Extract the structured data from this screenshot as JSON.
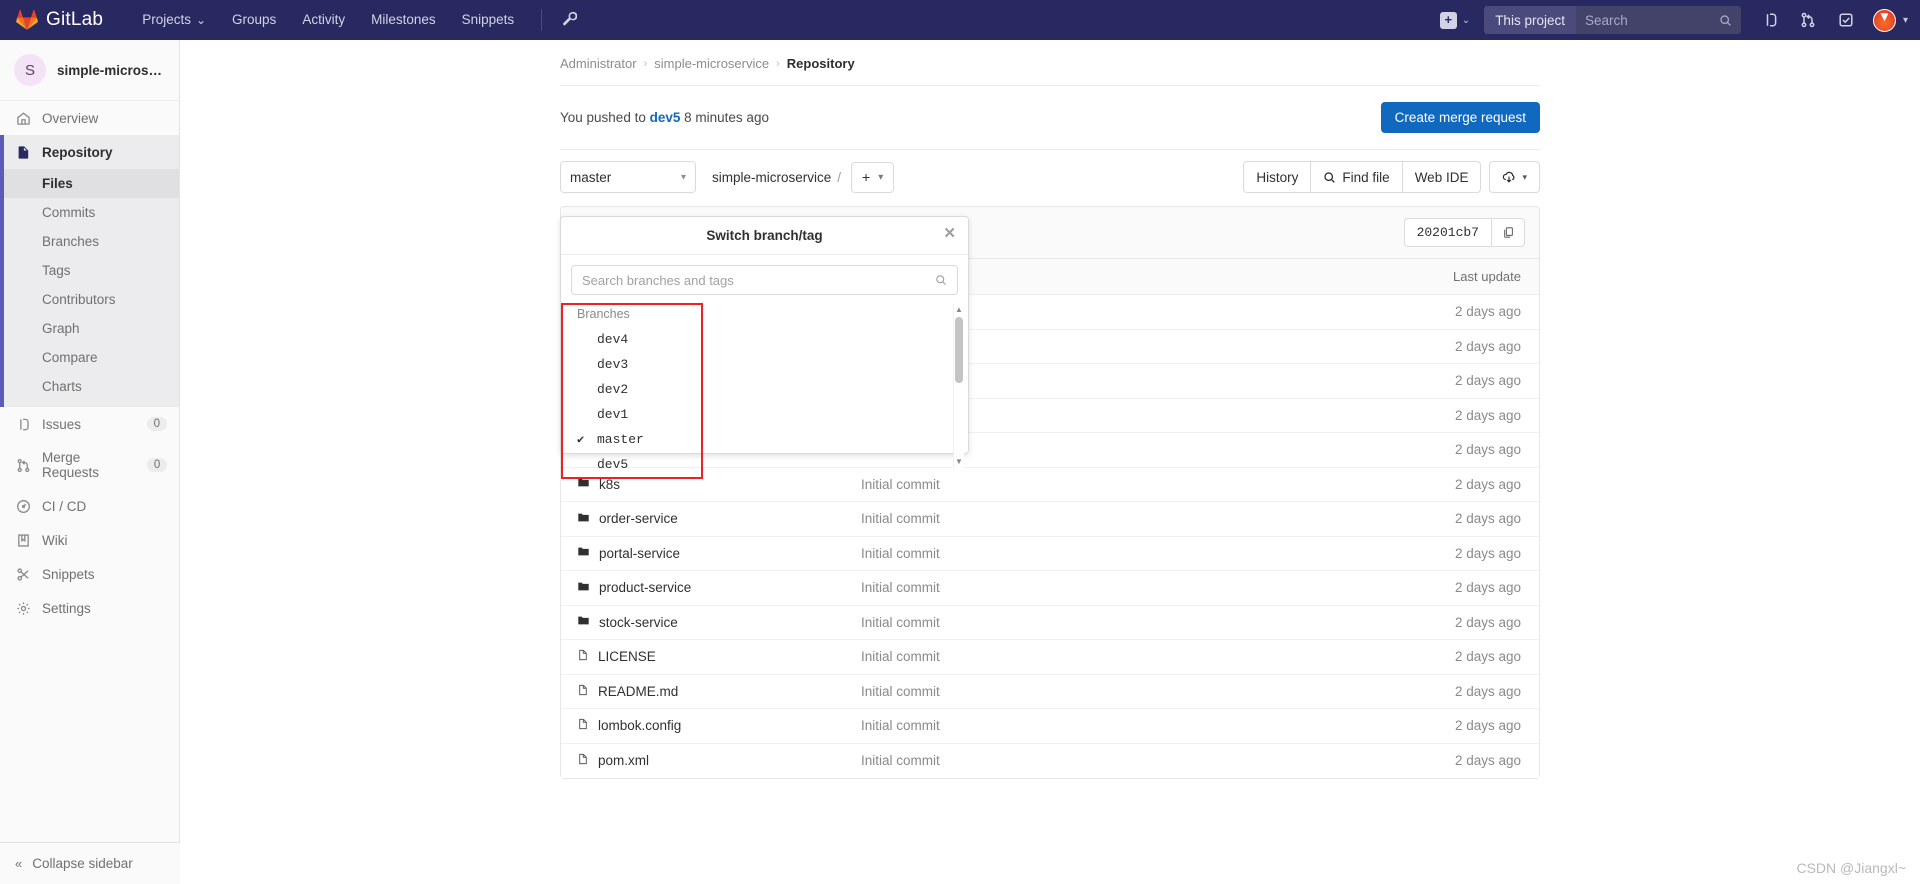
{
  "topnav": {
    "brand": "GitLab",
    "links": [
      {
        "label": "Projects",
        "caret": "⌄"
      },
      {
        "label": "Groups",
        "caret": ""
      },
      {
        "label": "Activity",
        "caret": ""
      },
      {
        "label": "Milestones",
        "caret": ""
      },
      {
        "label": "Snippets",
        "caret": ""
      }
    ],
    "wrench_icon": "wrench-icon",
    "plus_label": "+",
    "plus_caret": "⌄",
    "this_project": "This project",
    "search_placeholder": "Search",
    "icons": [
      "issues-icon",
      "merge-request-icon",
      "todos-icon"
    ],
    "avatar": "user-avatar"
  },
  "sidebar": {
    "project_initial": "S",
    "project_name": "simple-microservice",
    "items": [
      {
        "label": "Overview",
        "icon": "home-icon",
        "badge": ""
      },
      {
        "label": "Repository",
        "icon": "document-icon",
        "badge": ""
      },
      {
        "label": "Issues",
        "icon": "issues-icon",
        "badge": "0"
      },
      {
        "label": "Merge Requests",
        "icon": "merge-request-icon",
        "badge": "0"
      },
      {
        "label": "CI / CD",
        "icon": "rocket-icon",
        "badge": ""
      },
      {
        "label": "Wiki",
        "icon": "book-icon",
        "badge": ""
      },
      {
        "label": "Snippets",
        "icon": "snippet-icon",
        "badge": ""
      },
      {
        "label": "Settings",
        "icon": "gear-icon",
        "badge": ""
      }
    ],
    "repository_subitems": [
      "Files",
      "Commits",
      "Branches",
      "Tags",
      "Contributors",
      "Graph",
      "Compare",
      "Charts"
    ],
    "active_subitem": "Files",
    "collapse_label": "Collapse sidebar",
    "collapse_icon": "double-chevron-left-icon"
  },
  "breadcrumb": {
    "owner": "Administrator",
    "project": "simple-microservice",
    "section": "Repository",
    "separator": "›"
  },
  "push_notice": {
    "prefix": "You pushed to",
    "branch": "dev5",
    "suffix": "8 minutes ago",
    "button": "Create merge request"
  },
  "toolbar": {
    "branch_value": "master",
    "path_project": "simple-microservice",
    "path_slash": "/",
    "add_label": "+",
    "history": "History",
    "find_file": "Find file",
    "web_ide": "Web IDE",
    "download_icon": "download-cloud-icon"
  },
  "commit_bar": {
    "sha": "20201cb7",
    "copy_icon": "copy-icon"
  },
  "file_table": {
    "headers": {
      "name": "",
      "message": "",
      "last_update": "Last update"
    },
    "rows": [
      {
        "name": "k8s",
        "type": "folder",
        "message": "Initial commit",
        "updated": "2 days ago"
      },
      {
        "name": "order-service",
        "type": "folder",
        "message": "Initial commit",
        "updated": "2 days ago"
      },
      {
        "name": "portal-service",
        "type": "folder",
        "message": "Initial commit",
        "updated": "2 days ago"
      },
      {
        "name": "product-service",
        "type": "folder",
        "message": "Initial commit",
        "updated": "2 days ago"
      },
      {
        "name": "stock-service",
        "type": "folder",
        "message": "Initial commit",
        "updated": "2 days ago"
      },
      {
        "name": "LICENSE",
        "type": "file",
        "message": "Initial commit",
        "updated": "2 days ago"
      },
      {
        "name": "README.md",
        "type": "file",
        "message": "Initial commit",
        "updated": "2 days ago"
      },
      {
        "name": "lombok.config",
        "type": "file",
        "message": "Initial commit",
        "updated": "2 days ago"
      },
      {
        "name": "pom.xml",
        "type": "file",
        "message": "Initial commit",
        "updated": "2 days ago"
      }
    ],
    "hidden_rows_updated": [
      "2 days ago",
      "2 days ago",
      "2 days ago",
      "2 days ago",
      "2 days ago"
    ]
  },
  "branch_dropdown": {
    "title": "Switch branch/tag",
    "close_icon": "close-icon",
    "search_placeholder": "Search branches and tags",
    "search_icon": "search-icon",
    "group_label": "Branches",
    "branches": [
      {
        "name": "dev4",
        "selected": false
      },
      {
        "name": "dev3",
        "selected": false
      },
      {
        "name": "dev2",
        "selected": false
      },
      {
        "name": "dev1",
        "selected": false
      },
      {
        "name": "master",
        "selected": true
      },
      {
        "name": "dev5",
        "selected": false
      }
    ],
    "check_glyph": "✔",
    "highlight_color": "#f22020"
  },
  "watermark": "CSDN @Jiangxl~",
  "colors": {
    "nav_bg": "#292961",
    "primary": "#1068bf",
    "link": "#1068bf",
    "annotation": "#f22020"
  }
}
